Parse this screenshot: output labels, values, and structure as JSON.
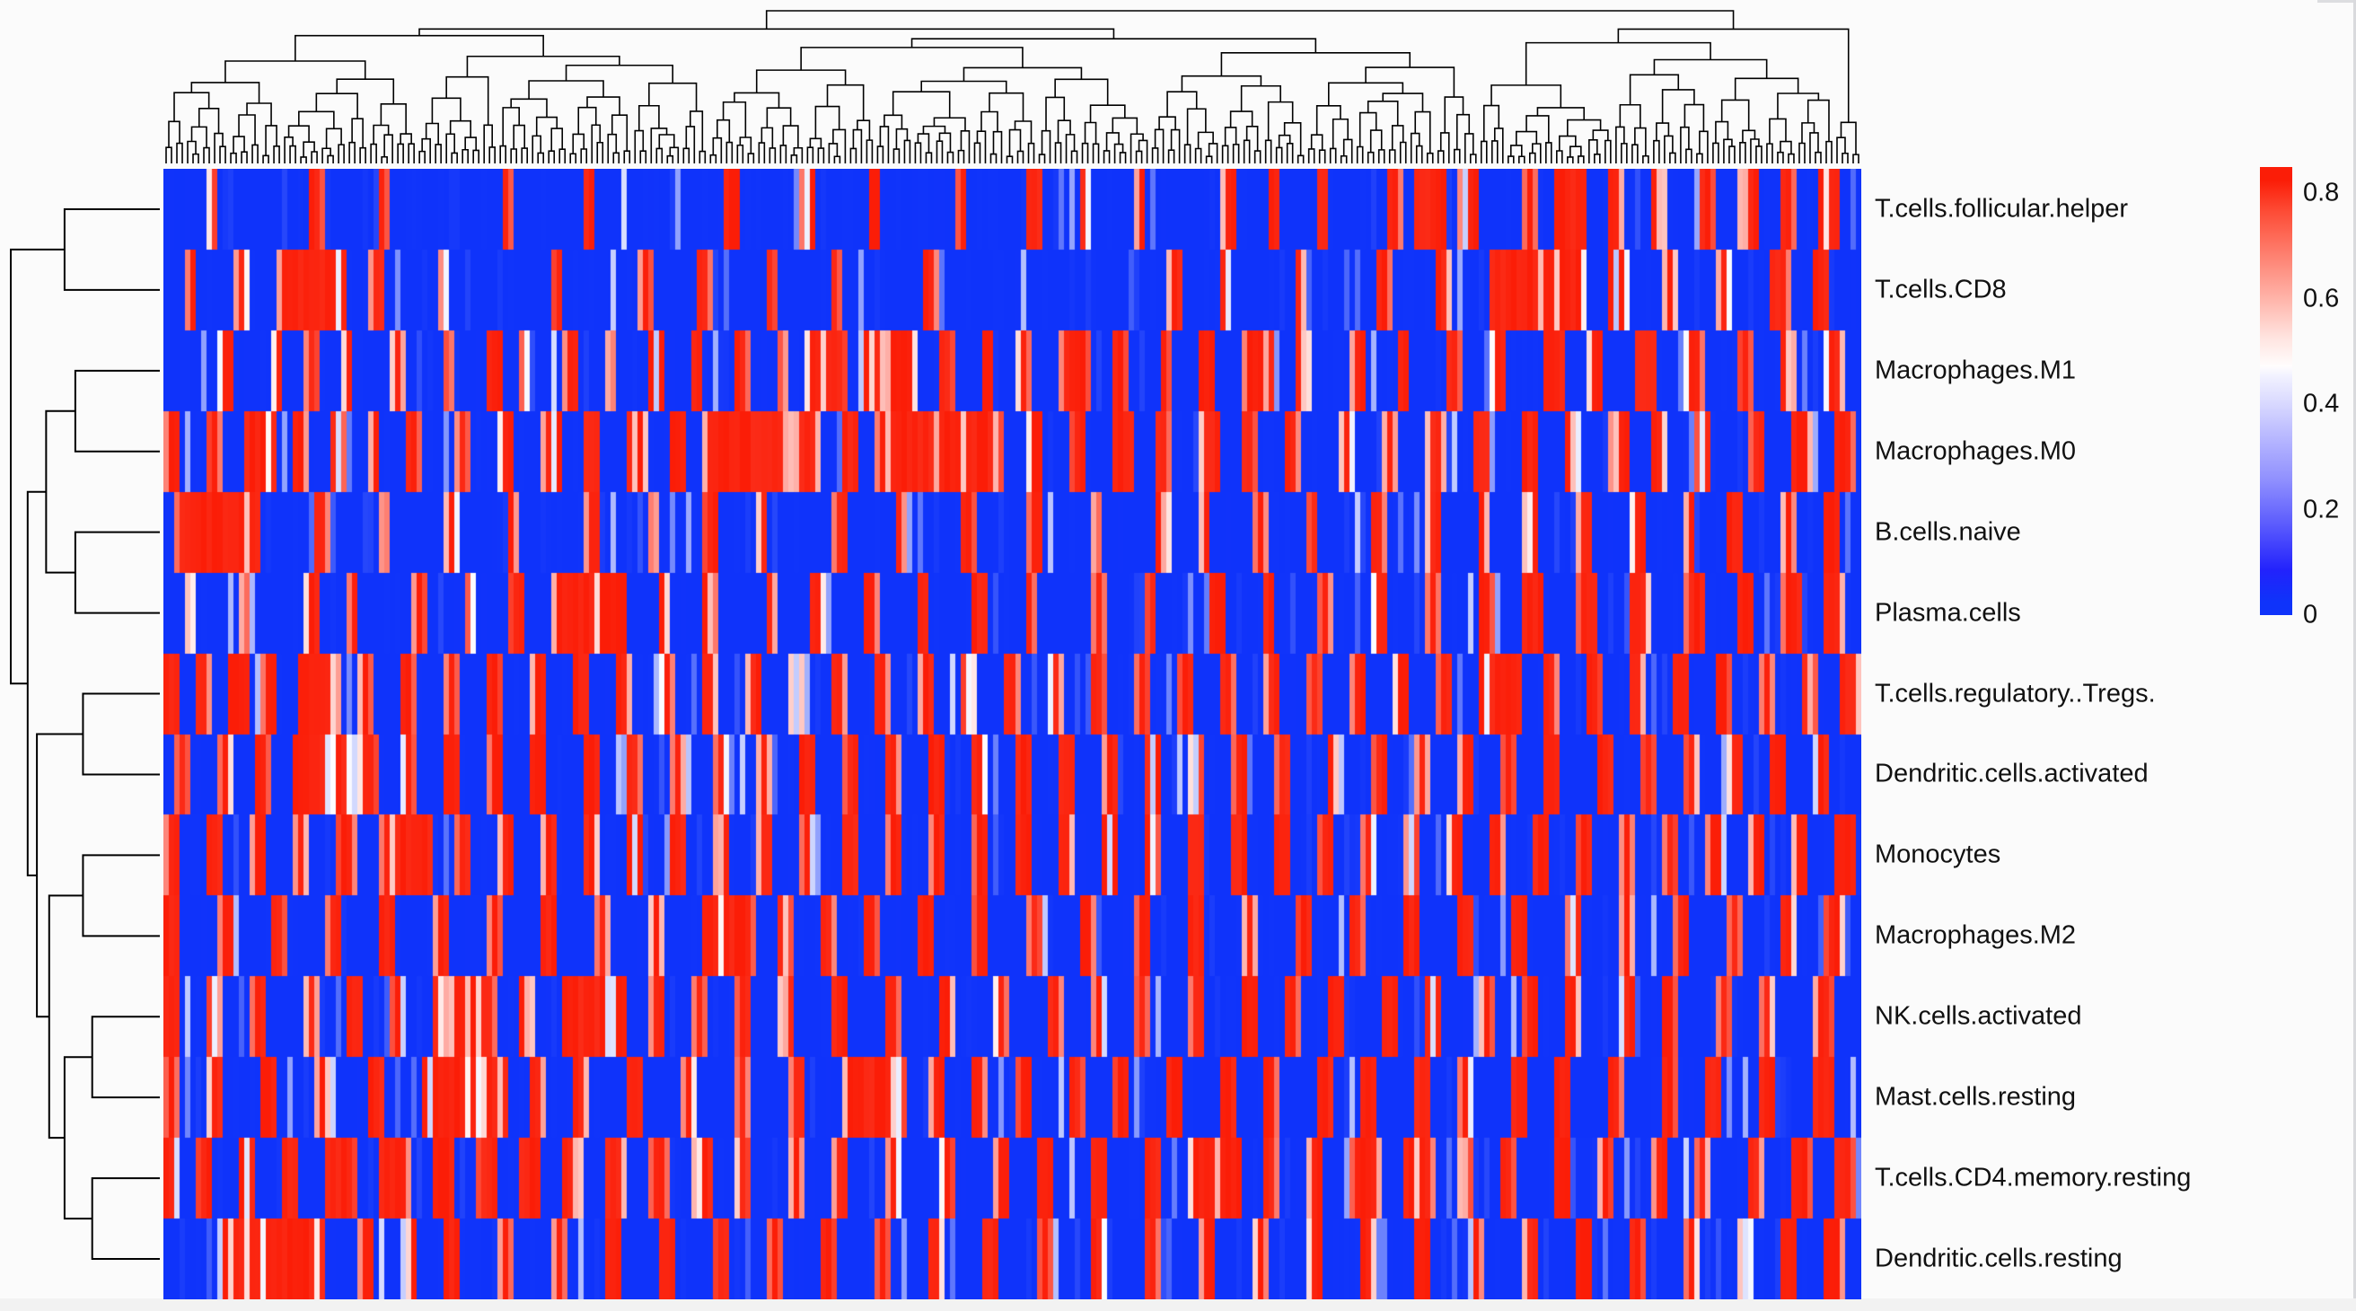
{
  "figure": {
    "type": "clustered-heatmap",
    "background_color": "#fbfbfb"
  },
  "chart_data": {
    "type": "heatmap",
    "title": "",
    "xlabel": "",
    "ylabel": "",
    "grid": false,
    "legend_position": "right",
    "colormap": {
      "name": "blue-white-red",
      "low_color": "#0f33fa",
      "mid_color": "#ffffff",
      "high_color": "#fb1d07",
      "vmin": 0,
      "vmax": 0.85,
      "mid_value": 0.42
    },
    "colorbar_ticks": [
      "0.8",
      "0.6",
      "0.4",
      "0.2",
      "0"
    ],
    "colorbar_tick_values": [
      0.8,
      0.6,
      0.4,
      0.2,
      0
    ],
    "row_labels": [
      "T.cells.follicular.helper",
      "T.cells.CD8",
      "Macrophages.M1",
      "Macrophages.M0",
      "B.cells.naive",
      "Plasma.cells",
      "T.cells.regulatory..Tregs.",
      "Dendritic.cells.activated",
      "Monocytes",
      "Macrophages.M2",
      "NK.cells.activated",
      "Mast.cells.resting",
      "T.cells.CD4.memory.resting",
      "Dendritic.cells.resting"
    ],
    "n_rows": 14,
    "n_columns": 315,
    "column_labels": [],
    "row_dendrogram": true,
    "column_dendrogram": true,
    "row_cluster_order": [
      "T.cells.follicular.helper",
      "T.cells.CD8",
      "Macrophages.M1",
      "Macrophages.M0",
      "B.cells.naive",
      "Plasma.cells",
      "T.cells.regulatory..Tregs.",
      "Dendritic.cells.activated",
      "Monocytes",
      "Macrophages.M2",
      "NK.cells.activated",
      "Mast.cells.resting",
      "T.cells.CD4.memory.resting",
      "Dendritic.cells.resting"
    ],
    "row_dendrogram_merges": [
      {
        "left": "T.cells.follicular.helper",
        "right": "T.cells.CD8",
        "height": 0.62
      },
      {
        "left": "Macrophages.M1",
        "right": "Macrophages.M0",
        "height": 0.55
      },
      {
        "left": "B.cells.naive",
        "right": "Plasma.cells",
        "height": 0.55
      },
      {
        "left": "T.cells.regulatory..Tregs.",
        "right": "Dendritic.cells.activated",
        "height": 0.5
      },
      {
        "left": "Monocytes",
        "right": "Macrophages.M2",
        "height": 0.5
      },
      {
        "left": "NK.cells.activated",
        "right": "Mast.cells.resting",
        "height": 0.44
      },
      {
        "left": "T.cells.CD4.memory.resting",
        "right": "Dendritic.cells.resting",
        "height": 0.44
      },
      {
        "left": "cluster-M1M0",
        "right": "cluster-BP",
        "height": 0.74
      },
      {
        "left": "cluster-NKMast",
        "right": "cluster-CD4DC",
        "height": 0.62
      },
      {
        "left": "cluster-TregDCact",
        "right": "cluster-MonoM2",
        "height": 0.7
      },
      {
        "left": "cluster-mid",
        "right": "cluster-low",
        "height": 0.8
      },
      {
        "left": "cluster-upper",
        "right": "cluster-rest",
        "height": 0.93
      }
    ],
    "value_legend_min_label": "0",
    "value_legend_max_label": "0.8",
    "notes": "Rows are immune cell fractions; values range 0 to ~0.85; most cells are at the low (blue) end with scattered high (red) columns."
  },
  "legend": {
    "ticks": [
      {
        "label": "0.8",
        "value": 0.8
      },
      {
        "label": "0.6",
        "value": 0.6
      },
      {
        "label": "0.4",
        "value": 0.4
      },
      {
        "label": "0.2",
        "value": 0.2
      },
      {
        "label": "0",
        "value": 0
      }
    ]
  }
}
